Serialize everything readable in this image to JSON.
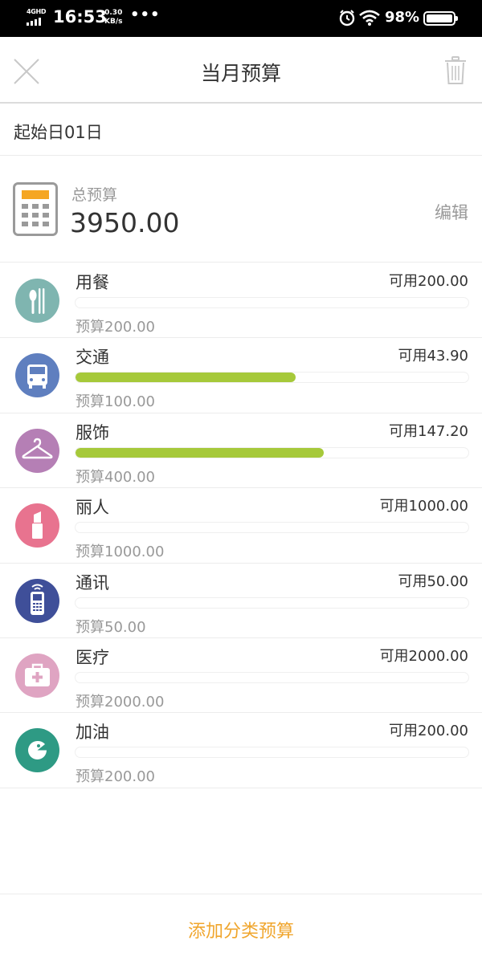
{
  "status_bar": {
    "network": "4GHD",
    "time": "16:53",
    "speed_value": "0.30",
    "speed_unit": "KB/s",
    "dots": "•••",
    "battery": "98%"
  },
  "header": {
    "title": "当月预算",
    "close_icon": "close-icon",
    "trash_icon": "trash-icon"
  },
  "start_day": {
    "label": "起始日01日"
  },
  "total": {
    "label": "总预算",
    "value": "3950.00",
    "edit_label": "编辑",
    "icon": "calculator-icon"
  },
  "categories": [
    {
      "name": "用餐",
      "available": "可用200.00",
      "budget": "预算200.00",
      "progress": 0,
      "icon": "utensils-icon",
      "color": "#7fb5b0"
    },
    {
      "name": "交通",
      "available": "可用43.90",
      "budget": "预算100.00",
      "progress": 0.561,
      "icon": "bus-icon",
      "color": "#5f7fbf"
    },
    {
      "name": "服饰",
      "available": "可用147.20",
      "budget": "预算400.00",
      "progress": 0.632,
      "icon": "hanger-icon",
      "color": "#b57fb5"
    },
    {
      "name": "丽人",
      "available": "可用1000.00",
      "budget": "预算1000.00",
      "progress": 0,
      "icon": "lipstick-icon",
      "color": "#e8738f"
    },
    {
      "name": "通讯",
      "available": "可用50.00",
      "budget": "预算50.00",
      "progress": 0,
      "icon": "phone-icon",
      "color": "#3f4f99"
    },
    {
      "name": "医疗",
      "available": "可用2000.00",
      "budget": "预算2000.00",
      "progress": 0,
      "icon": "medkit-icon",
      "color": "#dfa4c2"
    },
    {
      "name": "加油",
      "available": "可用200.00",
      "budget": "预算200.00",
      "progress": 0,
      "icon": "fuel-icon",
      "color": "#2e9a84"
    }
  ],
  "colors": {
    "accent": "#f0a62e",
    "progress": "#a6c93a",
    "calculator_top": "#f5a623"
  },
  "footer": {
    "add_label": "添加分类预算"
  }
}
